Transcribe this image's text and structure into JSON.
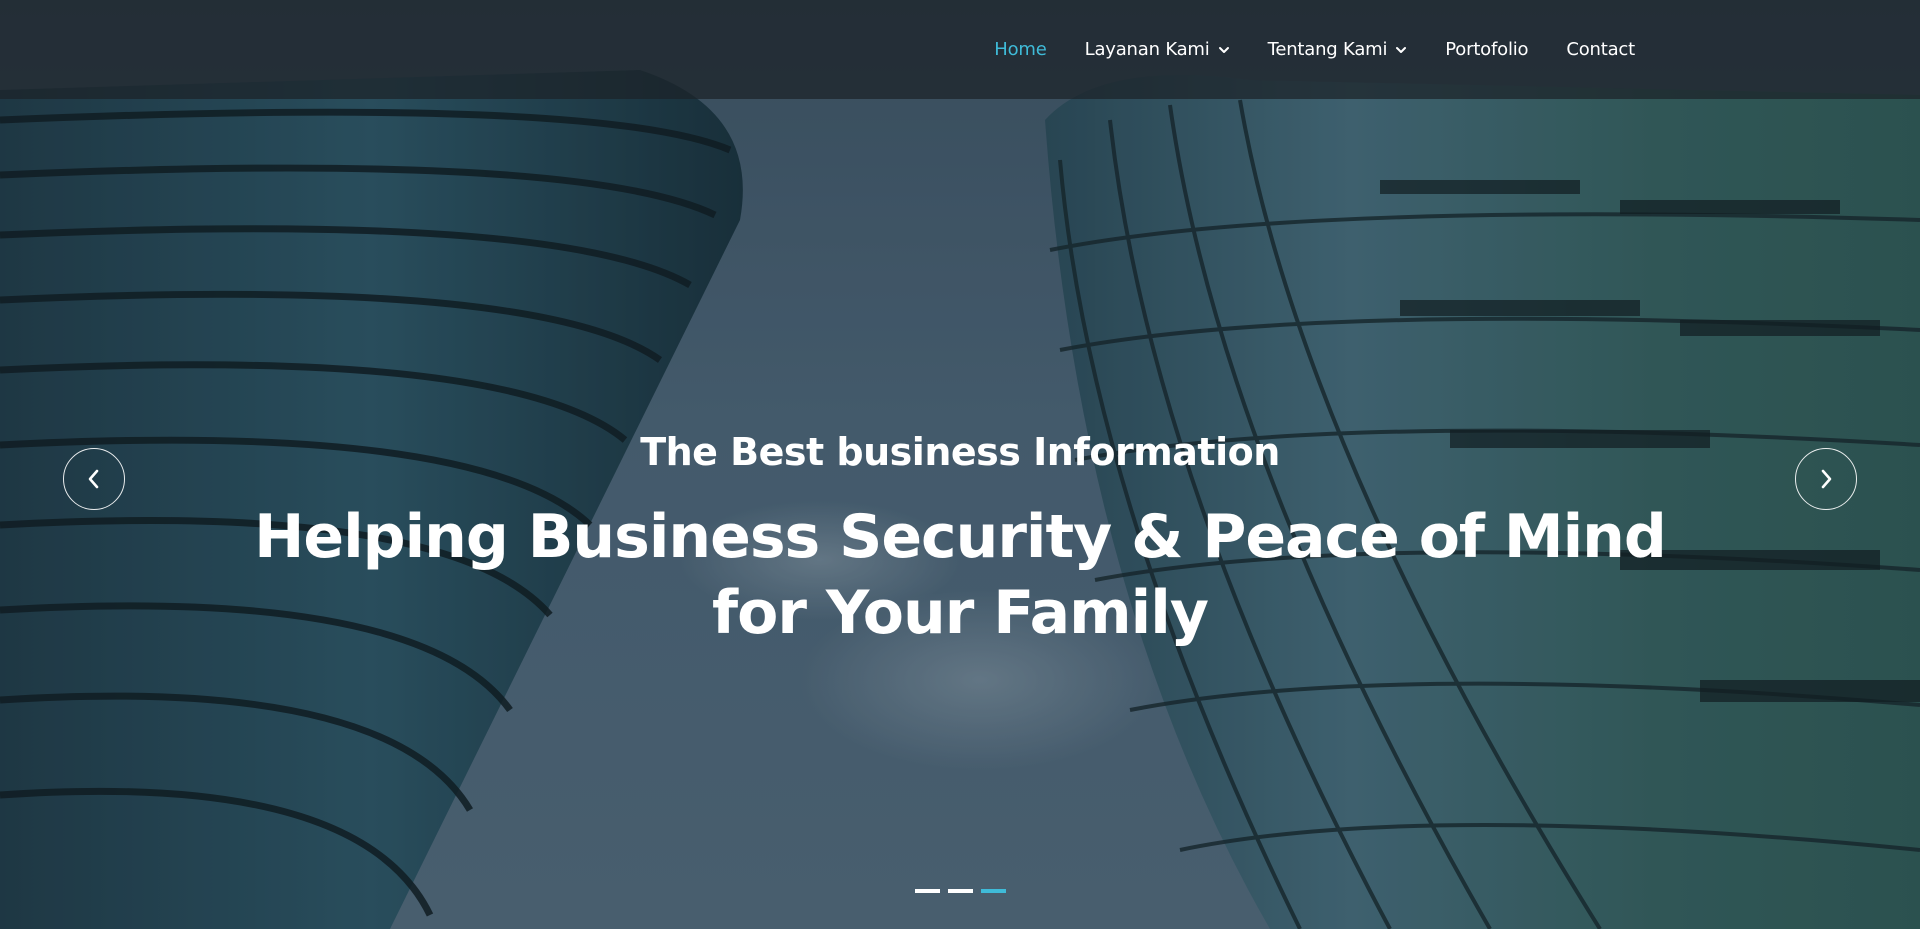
{
  "nav": {
    "items": [
      {
        "label": "Home",
        "active": true,
        "dropdown": false
      },
      {
        "label": "Layanan Kami",
        "active": false,
        "dropdown": true
      },
      {
        "label": "Tentang Kami",
        "active": false,
        "dropdown": true
      },
      {
        "label": "Portofolio",
        "active": false,
        "dropdown": false
      },
      {
        "label": "Contact",
        "active": false,
        "dropdown": false
      }
    ],
    "active_color": "#3fbbd8"
  },
  "hero": {
    "subtitle": "The Best business Information",
    "headline": "Helping Business Security & Peace of Mind for Your Family",
    "prev_icon": "chevron-left-icon",
    "next_icon": "chevron-right-icon",
    "slides_count": 3,
    "active_slide": 3,
    "background": "glass skyscrapers viewed from below against cloudy sky"
  }
}
